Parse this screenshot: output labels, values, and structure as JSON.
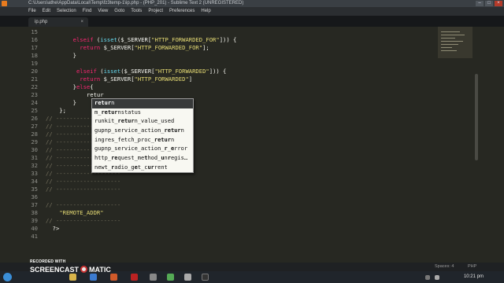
{
  "window": {
    "title": "C:\\Users\\athe\\AppData\\Local\\Temp\\fz3temp-1\\ip.php - (PHP_201) - Sublime Text 2 (UNREGISTERED)"
  },
  "menu": [
    "File",
    "Edit",
    "Selection",
    "Find",
    "View",
    "Goto",
    "Tools",
    "Project",
    "Preferences",
    "Help"
  ],
  "tab": {
    "label": "ip.php",
    "close": "×"
  },
  "code_lines": [
    {
      "n": "15",
      "html": ""
    },
    {
      "n": "16",
      "html": "        <span class=\"kw\">elseif</span> (<span class=\"fn\">isset</span>($_SERVER[<span class=\"str\">\"HTTP_FORWARDED_FOR\"</span>])) {"
    },
    {
      "n": "17",
      "html": "          <span class=\"kw\">return</span> $_SERVER[<span class=\"str\">\"HTTP_FORWARDED_FOR\"</span>];"
    },
    {
      "n": "18",
      "html": "        }"
    },
    {
      "n": "19",
      "html": ""
    },
    {
      "n": "20",
      "html": "         <span class=\"kw\">elseif</span> (<span class=\"fn\">isset</span>($_SERVER[<span class=\"str\">\"HTTP_FORWARDED\"</span>])) {"
    },
    {
      "n": "21",
      "html": "          <span class=\"kw\">return</span> $_SERVER[<span class=\"str\">\"HTTP_FORWARDED\"</span>]"
    },
    {
      "n": "22",
      "html": "        }<span class=\"kw\">else</span>{"
    },
    {
      "n": "23",
      "html": "            retur"
    },
    {
      "n": "24",
      "html": "        }"
    },
    {
      "n": "25",
      "html": "    };"
    },
    {
      "n": "26",
      "html": "<span class=\"cm\">// -------------------</span>"
    },
    {
      "n": "27",
      "html": "<span class=\"cm\">// -------------------</span>"
    },
    {
      "n": "28",
      "html": "<span class=\"cm\">// -------------------</span>"
    },
    {
      "n": "29",
      "html": "<span class=\"cm\">// -------------------</span>"
    },
    {
      "n": "30",
      "html": "<span class=\"cm\">// -------------------</span>"
    },
    {
      "n": "31",
      "html": "<span class=\"cm\">// -------------------</span>"
    },
    {
      "n": "32",
      "html": "<span class=\"cm\">// -------------------</span>"
    },
    {
      "n": "33",
      "html": "<span class=\"cm\">// -------------------</span>"
    },
    {
      "n": "34",
      "html": "<span class=\"cm\">// -------------------</span>"
    },
    {
      "n": "35",
      "html": "<span class=\"cm\">// -------------------</span>"
    },
    {
      "n": "36",
      "html": ""
    },
    {
      "n": "37",
      "html": "<span class=\"cm\">// -------------------</span>"
    },
    {
      "n": "38",
      "html": "    <span class=\"str\">\"REMOTE_ADDR\"</span>"
    },
    {
      "n": "39",
      "html": "<span class=\"cm\">// -------------------</span>"
    },
    {
      "n": "40",
      "html": "  ?>"
    },
    {
      "n": "41",
      "html": ""
    }
  ],
  "autocomplete": {
    "items": [
      {
        "html": "<b>retur</b>n",
        "selected": true
      },
      {
        "html": "m_<b>retur</b>nstatus",
        "selected": false
      },
      {
        "html": "runkit_<b>retur</b>n_value_used",
        "selected": false
      },
      {
        "html": "gupnp_service_action_<b>retur</b>n",
        "selected": false
      },
      {
        "html": "ingres_fetch_proc_<b>retur</b>n",
        "selected": false
      },
      {
        "html": "gupnp_service_action_<b>r</b>_<b>e</b>rror",
        "selected": false
      },
      {
        "html": "http_<b>re</b>quest_me<b>t</b>hod_<b>u</b>n<b>r</b>egis…",
        "selected": false
      },
      {
        "html": "newt_<b>r</b>adio_g<b>e</b>t_c<b>ur</b>rent",
        "selected": false
      }
    ]
  },
  "statusbar": {
    "left": "",
    "spaces": "Spaces: 4",
    "language": "PHP"
  },
  "watermark": {
    "line1": "RECORDED WITH",
    "line2a": "SCREENCAST",
    "line2b": "MATIC"
  },
  "clock": "10:21 pm"
}
